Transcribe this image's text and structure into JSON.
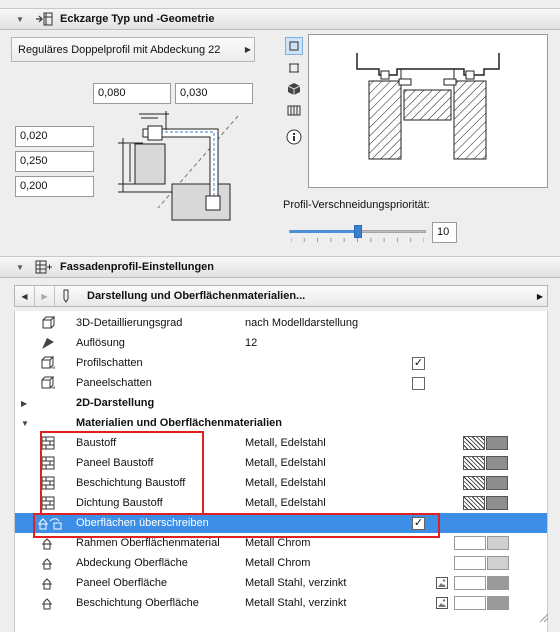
{
  "colors": {
    "highlight": "#3d8ee6",
    "red_outline": "#e02020",
    "slider_blue": "#3a7fd0"
  },
  "geometry_section": {
    "title": "Eckzarge Typ und -Geometrie",
    "icon": "frame-corner-icon",
    "profile_dropdown": "Reguläres Doppelprofil mit Abdeckung 22",
    "inputs_top": [
      "0,080",
      "0,030"
    ],
    "inputs_left": [
      "0,020",
      "0,250",
      "0,200"
    ],
    "view_icons": [
      "plan-view-icon",
      "section-view-icon",
      "3d-view-icon",
      "library-view-icon",
      "info-icon"
    ],
    "priority_label": "Profil-Verschneidungspriorität:",
    "priority_value": "10",
    "priority_fraction": 0.5
  },
  "facade_section": {
    "title": "Fassadenprofil-Einstellungen",
    "icon": "facade-settings-icon",
    "nav_title": "Darstellung und Oberflächenmaterialien...",
    "rows": {
      "detail": {
        "name": "3D-Detaillierungsgrad",
        "value": "nach Modelldarstellung"
      },
      "resolution": {
        "name": "Auflösung",
        "value": "12"
      },
      "profile_shadow": {
        "name": "Profilschatten",
        "checked": true
      },
      "panel_shadow": {
        "name": "Paneelschatten",
        "checked": false
      },
      "group_2d": "2D-Darstellung",
      "group_materials": "Materialien und Oberflächenmaterialien",
      "baustoff": {
        "name": "Baustoff",
        "value": "Metall, Edelstahl"
      },
      "panel_baustoff": {
        "name": "Paneel Baustoff",
        "value": "Metall, Edelstahl"
      },
      "coating_baustoff": {
        "name": "Beschichtung Baustoff",
        "value": "Metall, Edelstahl"
      },
      "seal_baustoff": {
        "name": "Dichtung Baustoff",
        "value": "Metall, Edelstahl"
      },
      "override": {
        "name": "Oberflächen überschreiben",
        "checked": true
      },
      "frame_surface": {
        "name": "Rahmen Oberflächenmaterial",
        "value": "Metall Chrom"
      },
      "cover_surface": {
        "name": "Abdeckung Oberfläche",
        "value": "Metall Chrom"
      },
      "panel_surface": {
        "name": "Paneel Oberfläche",
        "value": "Metall Stahl, verzinkt"
      },
      "coating_surface": {
        "name": "Beschichtung Oberfläche",
        "value": "Metall Stahl, verzinkt"
      }
    }
  }
}
